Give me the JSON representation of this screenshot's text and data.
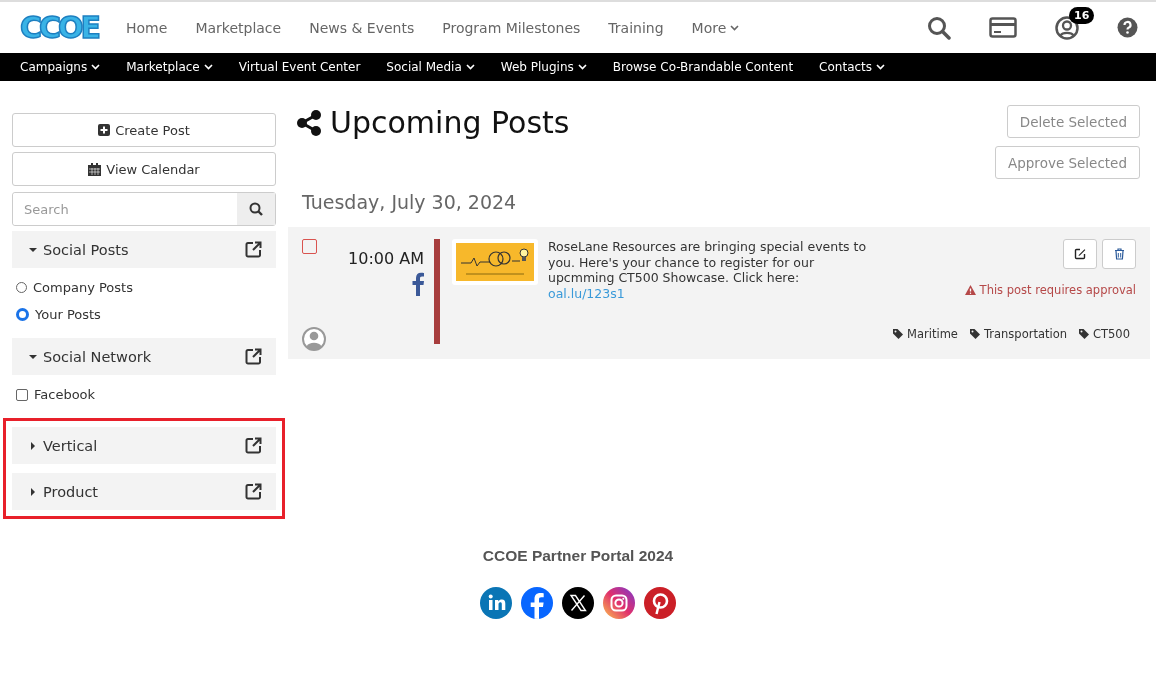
{
  "logo": "CCOE",
  "top_nav": [
    {
      "label": "Home",
      "dropdown": false
    },
    {
      "label": "Marketplace",
      "dropdown": false
    },
    {
      "label": "News & Events",
      "dropdown": false
    },
    {
      "label": "Program Milestones",
      "dropdown": false
    },
    {
      "label": "Training",
      "dropdown": false
    },
    {
      "label": "More",
      "dropdown": true
    }
  ],
  "notification_count": "16",
  "sub_nav": [
    {
      "label": "Campaigns",
      "dropdown": true
    },
    {
      "label": "Marketplace",
      "dropdown": true
    },
    {
      "label": "Virtual Event Center",
      "dropdown": false
    },
    {
      "label": "Social Media",
      "dropdown": true
    },
    {
      "label": "Web Plugins",
      "dropdown": true
    },
    {
      "label": "Browse Co-Brandable Content",
      "dropdown": false
    },
    {
      "label": "Contacts",
      "dropdown": true
    }
  ],
  "sidebar": {
    "buttons": [
      {
        "label": "Create Post",
        "kind": "create"
      },
      {
        "label": "View Calendar",
        "kind": "calendar"
      }
    ],
    "search": {
      "placeholder": "Search"
    },
    "sections": [
      {
        "title": "Social Posts",
        "expanded": true,
        "highlighted": false,
        "kind": "radio",
        "options": [
          {
            "label": "Company Posts",
            "selected": false
          },
          {
            "label": "Your Posts",
            "selected": true
          }
        ]
      },
      {
        "title": "Social Network",
        "expanded": true,
        "highlighted": false,
        "kind": "checkbox",
        "options": [
          {
            "label": "Facebook",
            "checked": false
          }
        ]
      },
      {
        "title": "Vertical",
        "expanded": false,
        "highlighted": true
      },
      {
        "title": "Product",
        "expanded": false,
        "highlighted": true
      }
    ]
  },
  "page_title": "Upcoming Posts",
  "actions": [
    {
      "label": "Delete Selected"
    },
    {
      "label": "Approve Selected"
    }
  ],
  "date_heading": "Tuesday, July 30, 2024",
  "posts": [
    {
      "checked": false,
      "time": "10:00 AM",
      "text": "RoseLane Resources are bringing special events to you. Here's your chance to register for our upcmming CT500 Showcase. Click here:",
      "link": "oal.lu/123s1",
      "requires_approval": true,
      "approval_note": "This post requires approval",
      "tags": [
        "Maritime",
        "Transportation",
        "CT500"
      ]
    }
  ],
  "footer": {
    "text": "CCOE Partner Portal 2024"
  }
}
